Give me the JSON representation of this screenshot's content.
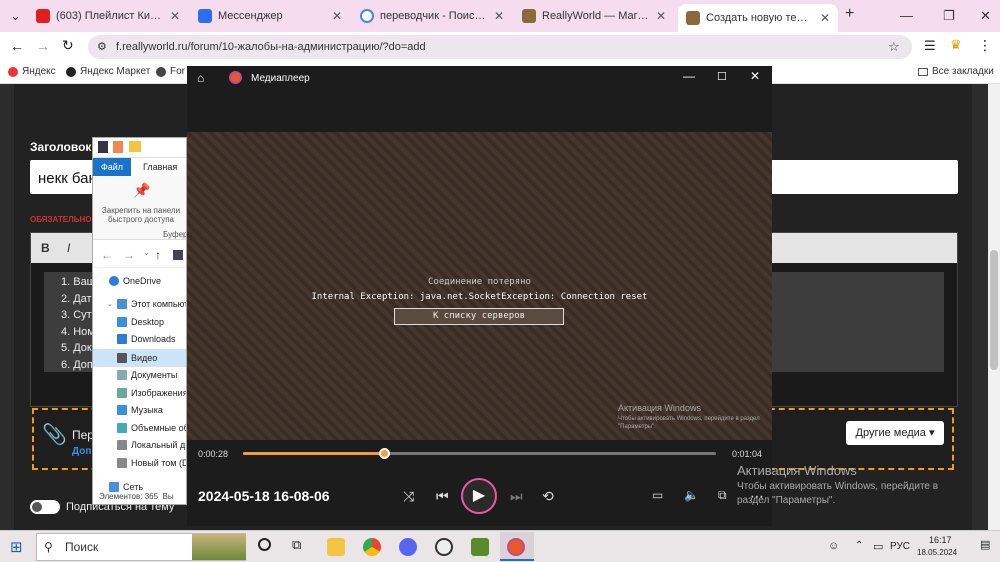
{
  "browser": {
    "tabs": [
      {
        "title": "(603) Плейлист Кишлак",
        "color": "#e02020"
      },
      {
        "title": "Мессенджер",
        "color": "#2a6ff0"
      },
      {
        "title": "переводчик - Поиск в Goo",
        "color": "#4285f4"
      },
      {
        "title": "ReallyWorld — Магазин пр",
        "color": "#8a6a3a"
      },
      {
        "title": "Создать новую тему - Reall",
        "color": "#8a6a3a"
      }
    ],
    "url": "f.reallyworld.ru/forum/10-жалобы-на-администрацию/?do=add",
    "bookmarks": [
      "Яндекс",
      "Яндекс Маркет",
      "For"
    ],
    "all_bookmarks": "Все закладки"
  },
  "forum": {
    "title_label": "Заголовок",
    "title_value": "некк бан",
    "required": "ОБЯЗАТЕЛЬНО",
    "bold": "B",
    "italic": "I",
    "list": [
      "1. Ваш",
      "2. Дат",
      "3. Сут",
      "4. Ном",
      "5. Док",
      "6. Доп"
    ],
    "attach_text": "Пер",
    "attach_sub": "Доп",
    "more_media": "Другие медиа ▾",
    "subscribe": "Подписаться на тему"
  },
  "explorer": {
    "ribbon_tabs": [
      "Файл",
      "Главная"
    ],
    "pin_label": "Закрепить на панели быстрого доступа",
    "clipboard": "Буфер",
    "tree": [
      {
        "label": "OneDrive",
        "color": "#2a7fd4"
      },
      {
        "label": "Этот компьютер",
        "color": "#4a90d9"
      },
      {
        "label": "Desktop",
        "color": "#3a8ee6"
      },
      {
        "label": "Downloads",
        "color": "#2d7dd2"
      },
      {
        "label": "Видео",
        "color": "#555"
      },
      {
        "label": "Документы",
        "color": "#8aa"
      },
      {
        "label": "Изображения",
        "color": "#6a9"
      },
      {
        "label": "Музыка",
        "color": "#3a8ee6"
      },
      {
        "label": "Объемные об",
        "color": "#4ab"
      },
      {
        "label": "Локальный ди",
        "color": "#888"
      },
      {
        "label": "Новый том (D",
        "color": "#888"
      },
      {
        "label": "Сеть",
        "color": "#4a90d9"
      }
    ],
    "status": "Элементов: 365",
    "status2": "Вы"
  },
  "player": {
    "app_title": "Медиаплеер",
    "conn_lost": "Соединение потеряно",
    "exception": "Internal Exception: java.net.SocketException: Connection reset",
    "server_button": "К списку серверов",
    "activation_title": "Активация Windows",
    "activation_body": "Чтобы активировать Windows, перейдите в раздел \"Параметры\".",
    "time_current": "0:00:28",
    "time_total": "0:01:04",
    "progress": 0.3,
    "file_title": "2024-05-18 16-08-06"
  },
  "desktop_watermark": {
    "title": "Активация Windows",
    "line1": "Чтобы активировать Windows, перейдите в",
    "line2": "раздел \"Параметры\"."
  },
  "taskbar": {
    "search": "Поиск",
    "lang": "РУС",
    "time": "16:17",
    "date": "18.05.2024"
  }
}
